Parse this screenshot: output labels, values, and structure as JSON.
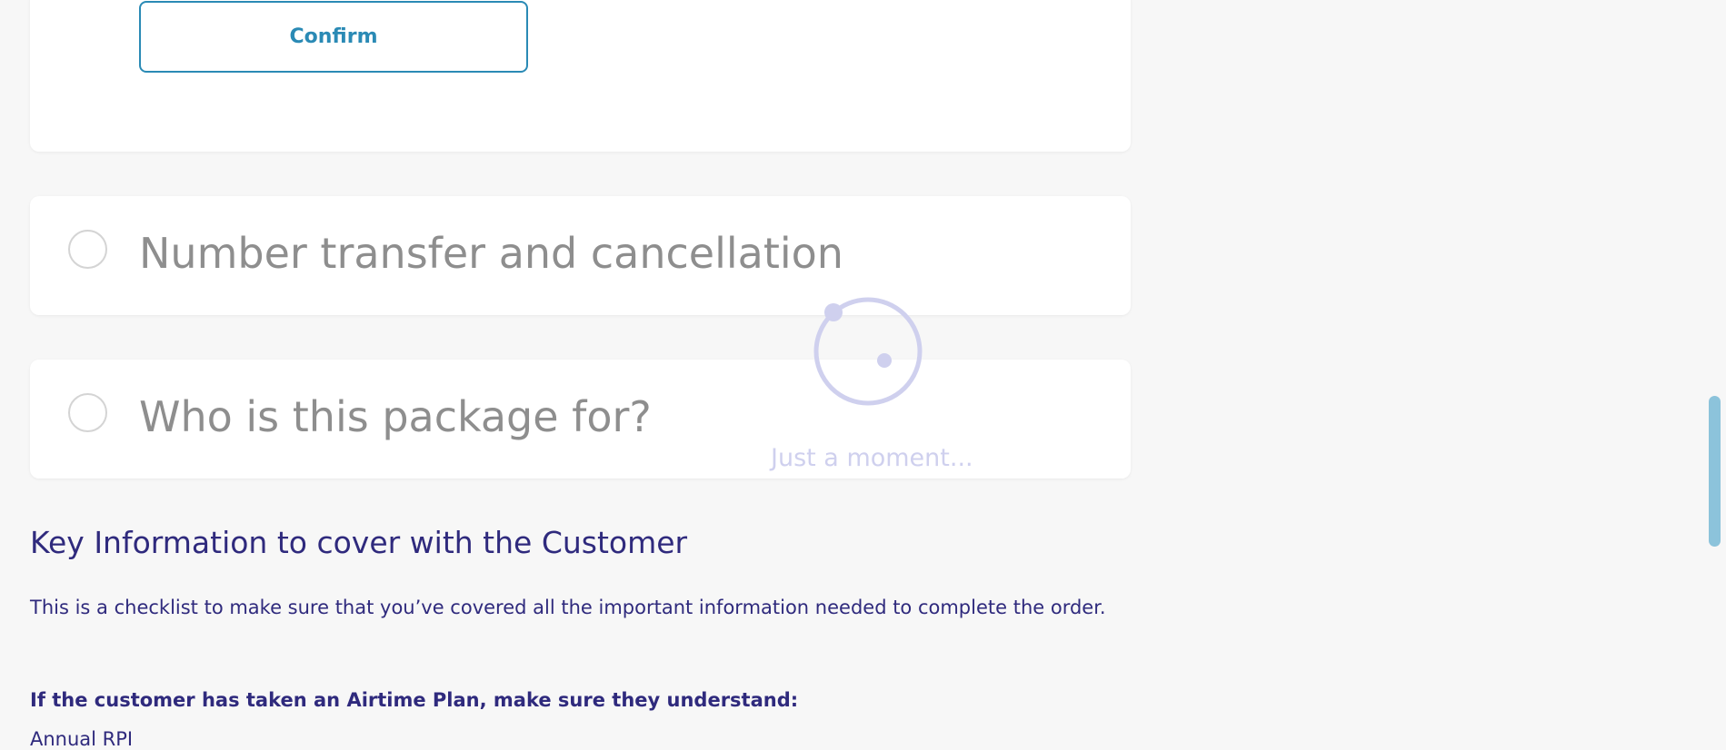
{
  "confirm_section": {
    "confirm_label": "Confirm"
  },
  "sections": [
    {
      "title": "Number transfer and cancellation"
    },
    {
      "title": "Who is this package for?"
    }
  ],
  "loader": {
    "text": "Just a moment..."
  },
  "key_info": {
    "heading": "Key Information to cover with the Customer",
    "description": "This is a checklist to make sure that you’ve covered all the important information needed to complete the order.",
    "airtime_heading": "If the customer has taken an Airtime Plan, make sure they understand:",
    "next_item": "Annual RPI"
  },
  "colors": {
    "accent": "#2a8ab5",
    "heading": "#2f2a7d",
    "muted_title": "#8e8e8e",
    "loader": "#cfd0ee",
    "scrollbar": "#8cc3db",
    "background": "#f7f7f7"
  }
}
